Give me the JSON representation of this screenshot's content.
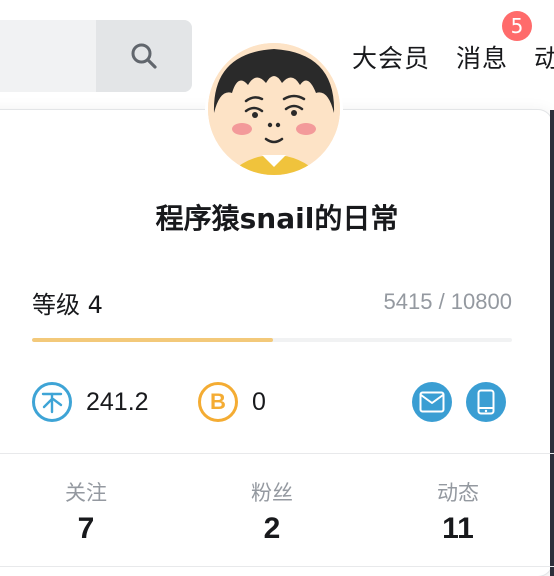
{
  "header": {
    "search": {
      "value": "",
      "placeholder": ""
    },
    "nav": [
      {
        "label": "大会员"
      },
      {
        "label": "消息",
        "badge": "5"
      },
      {
        "label": "动"
      }
    ]
  },
  "profile": {
    "username": "程序猿snail的日常",
    "level": {
      "label": "等级 4",
      "exp_text": "5415 / 10800",
      "progress": 0.5014
    },
    "coins": [
      {
        "icon": "ying-coin-icon",
        "symbol": "币",
        "value": "241.2"
      },
      {
        "icon": "b-coin-icon",
        "symbol": "B",
        "value": "0"
      }
    ],
    "actions": [
      {
        "icon": "mail-icon"
      },
      {
        "icon": "phone-icon"
      }
    ],
    "stats": [
      {
        "label": "关注",
        "value": "7"
      },
      {
        "label": "粉丝",
        "value": "2"
      },
      {
        "label": "动态",
        "value": "11"
      }
    ]
  },
  "colors": {
    "accent_blue": "#3a9ed3",
    "coin_gold": "#f4ac33",
    "progress_fill": "#f3c97a",
    "badge_red": "#ff6b6b"
  }
}
